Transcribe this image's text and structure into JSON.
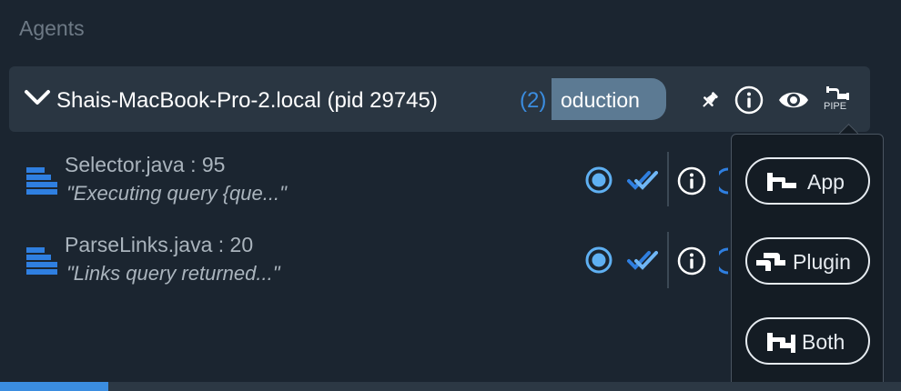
{
  "section": {
    "title": "Agents"
  },
  "agent": {
    "name": "Shais-MacBook-Pro-2.local (pid 29745)",
    "count": "(2)",
    "environment_visible": "oduction"
  },
  "header_icons": {
    "pipe_label": "PIPE"
  },
  "breakpoints": [
    {
      "file": "Selector.java : 95",
      "message": "\"Executing query {que...\""
    },
    {
      "file": "ParseLinks.java : 20",
      "message": "\"Links query returned...\""
    }
  ],
  "pipe_menu": {
    "app_label": "App",
    "plugin_label": "Plugin",
    "both_label": "Both"
  },
  "progress": {
    "value": 0.12
  },
  "colors": {
    "accent": "#3b8de0",
    "background": "#1b2530",
    "row": "#2a3642",
    "environment_pill": "#5c7a93"
  }
}
